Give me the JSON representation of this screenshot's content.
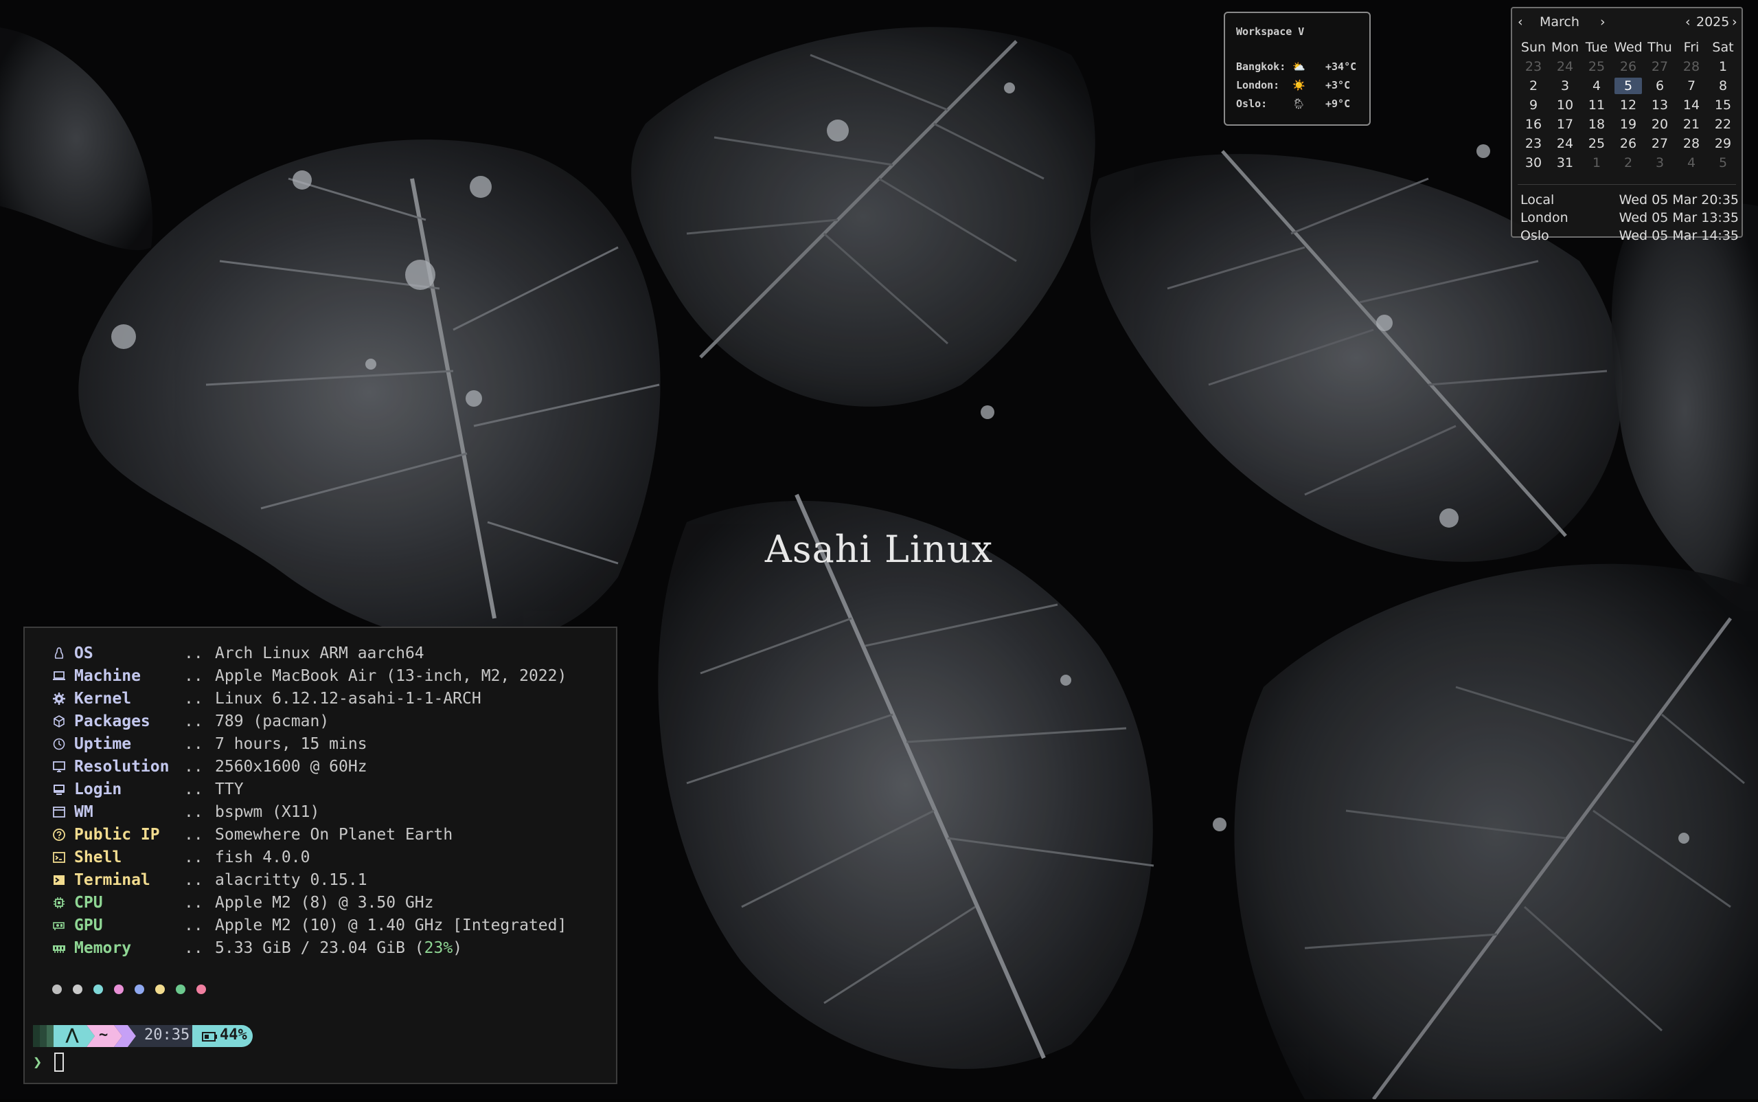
{
  "desktop": {
    "wallpaper_title": "Asahi Linux"
  },
  "weather": {
    "workspace": "Workspace V",
    "rows": [
      {
        "city": "Bangkok:",
        "icon": "⛅",
        "temp": "+34°C"
      },
      {
        "city": "London:",
        "icon": "☀️",
        "temp": "+3°C"
      },
      {
        "city": "Oslo:",
        "icon": "🌦",
        "temp": "+9°C"
      }
    ]
  },
  "calendar": {
    "prev_month": "‹",
    "month": "March",
    "next_month": "›",
    "prev_year": "‹",
    "year": "2025",
    "next_year": "›",
    "weekdays": [
      "Sun",
      "Mon",
      "Tue",
      "Wed",
      "Thu",
      "Fri",
      "Sat"
    ],
    "weeks": [
      [
        "23",
        "24",
        "25",
        "26",
        "27",
        "28",
        "1"
      ],
      [
        "2",
        "3",
        "4",
        "5",
        "6",
        "7",
        "8"
      ],
      [
        "9",
        "10",
        "11",
        "12",
        "13",
        "14",
        "15"
      ],
      [
        "16",
        "17",
        "18",
        "19",
        "20",
        "21",
        "22"
      ],
      [
        "23",
        "24",
        "25",
        "26",
        "27",
        "28",
        "29"
      ],
      [
        "30",
        "31",
        "1",
        "2",
        "3",
        "4",
        "5"
      ]
    ],
    "today": "5",
    "clocks": [
      {
        "label": "Local",
        "time": "Wed 05 Mar 20:35"
      },
      {
        "label": "London",
        "time": "Wed 05 Mar 13:35"
      },
      {
        "label": "Oslo",
        "time": "Wed 05 Mar 14:35"
      }
    ]
  },
  "terminal": {
    "fetch": [
      {
        "icon": "linux-icon",
        "key": "OS",
        "value": "Arch Linux ARM aarch64",
        "color": "#c4c8ee"
      },
      {
        "icon": "laptop-icon",
        "key": "Machine",
        "value": "Apple MacBook Air (13-inch, M2, 2022)",
        "color": "#c4c8ee"
      },
      {
        "icon": "gear-icon",
        "key": "Kernel",
        "value": "Linux 6.12.12-asahi-1-1-ARCH",
        "color": "#c4c8ee"
      },
      {
        "icon": "package-icon",
        "key": "Packages",
        "value": "789 (pacman)",
        "color": "#c4c8ee"
      },
      {
        "icon": "clock-icon",
        "key": "Uptime",
        "value": "7 hours, 15 mins",
        "color": "#c4c8ee"
      },
      {
        "icon": "monitor-icon",
        "key": "Resolution",
        "value": "2560x1600 @ 60Hz",
        "color": "#c4c8ee"
      },
      {
        "icon": "login-icon",
        "key": "Login",
        "value": "TTY",
        "color": "#c4c8ee"
      },
      {
        "icon": "window-icon",
        "key": "WM",
        "value": "bspwm (X11)",
        "color": "#c4c8ee"
      },
      {
        "icon": "question-icon",
        "key": "Public IP",
        "value": "Somewhere On Planet Earth",
        "color": "#f2dc8f"
      },
      {
        "icon": "shell-icon",
        "key": "Shell",
        "value": "fish 4.0.0",
        "color": "#f2dc8f"
      },
      {
        "icon": "terminal-icon",
        "key": "Terminal",
        "value": "alacritty 0.15.1",
        "color": "#f2dc8f"
      },
      {
        "icon": "cpu-icon",
        "key": "CPU",
        "value": "Apple M2 (8) @ 3.50 GHz",
        "color": "#8fd694"
      },
      {
        "icon": "gpu-icon",
        "key": "GPU",
        "value": "Apple M2 (10) @ 1.40 GHz [Integrated]",
        "color": "#8fd694"
      },
      {
        "icon": "memory-icon",
        "key": "Memory",
        "value": "5.33 GiB / 23.04 GiB (",
        "pct": "23%",
        "tail": ")",
        "color": "#8fd694"
      }
    ],
    "separator": "..",
    "palette": [
      "#bdbdbd",
      "#c9c9c9",
      "#7fd8d8",
      "#e890d6",
      "#8fa8f0",
      "#f2dc8f",
      "#6cc98e",
      "#f07fa0"
    ],
    "prompt": {
      "arch_symbol": "⋀",
      "dir": "~",
      "time": "20:35",
      "battery_icon": "battery-icon",
      "battery": "44%",
      "char": "❯"
    },
    "colors": {
      "green_seg": "#2a4a3a",
      "teal_seg": "#7fd8d8",
      "pink_seg": "#f4b8e4",
      "time_seg": "#2e3340",
      "battery_seg": "#7fd8d8"
    }
  }
}
